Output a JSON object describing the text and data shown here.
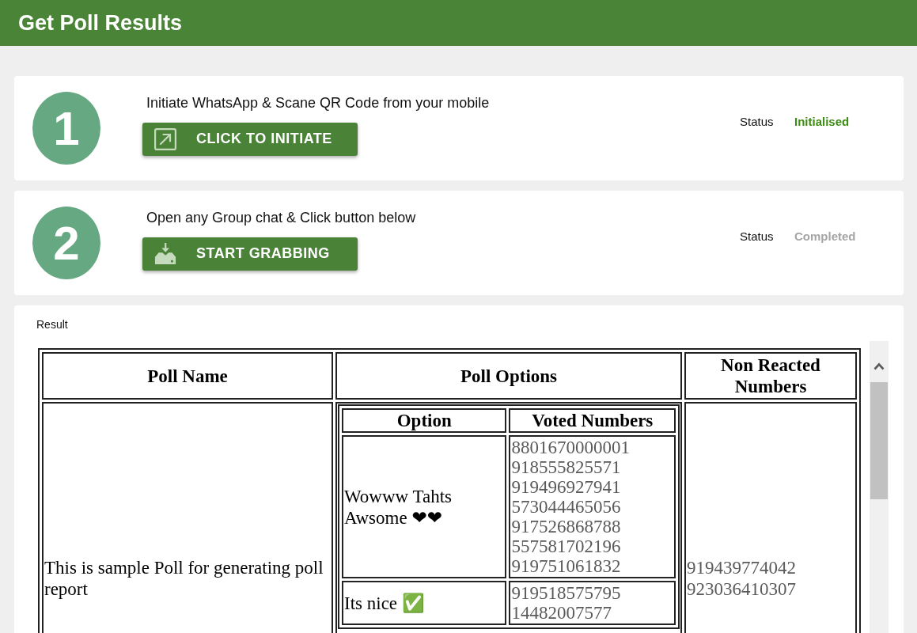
{
  "window": {
    "title": "Get Poll Results"
  },
  "steps": [
    {
      "kind": "initiate",
      "number": "1",
      "instruction": "Initiate WhatsApp & Scane QR Code from your mobile",
      "button": "CLICK TO INITIATE",
      "status": {
        "label": "Status",
        "value": "Initialised",
        "active": true
      }
    },
    {
      "kind": "grab",
      "number": "2",
      "instruction": "Open any Group chat & Click button below",
      "button": "START GRABBING",
      "status": {
        "label": "Status",
        "value": "Completed",
        "active": false
      }
    }
  ],
  "result": {
    "label": "Result",
    "table": {
      "columns": [
        "Poll Name",
        "Poll Options",
        "Non Reacted Numbers"
      ],
      "rows": [
        {
          "poll_name": "This is sample Poll for generating poll report",
          "options": {
            "columns": [
              "Option",
              "Voted Numbers"
            ],
            "rows": [
              {
                "option": "Wowww Tahts Awsome ❤❤",
                "voted_numbers": [
                  "8801670000001",
                  "918555825571",
                  "919496927941",
                  "573044465056",
                  "917526868788",
                  "557581702196",
                  "919751061832"
                ]
              },
              {
                "option": "Its nice ✅",
                "voted_numbers": [
                  "919518575795",
                  "14482007577"
                ]
              }
            ]
          },
          "non_reacted_numbers": [
            "919439774042",
            "923036410307"
          ]
        }
      ]
    }
  }
}
